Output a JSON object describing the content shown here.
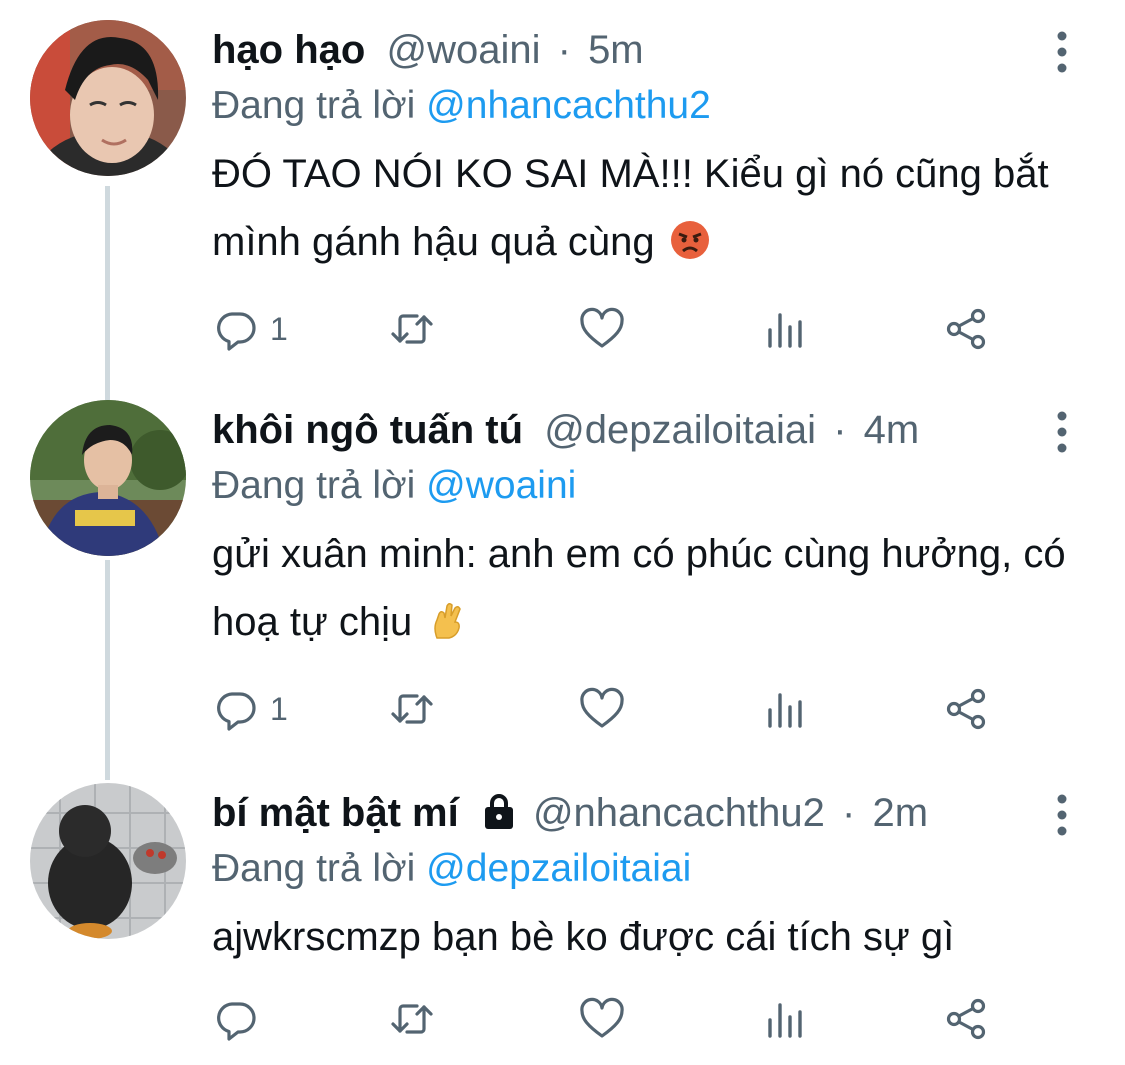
{
  "tweets": [
    {
      "name": "hạo hạo",
      "handle": "@woaini",
      "sep": "·",
      "time": "5m",
      "reply_prefix": "Đang trả lời",
      "reply_to": "@nhancachthu2",
      "text": "ĐÓ TAO NÓI KO SAI MÀ!!! Kiểu gì nó cũng bắt mình gánh hậu quả cùng",
      "emoji_icon": "angry-face-icon",
      "reply_count": "1",
      "locked": false
    },
    {
      "name": "khôi ngô tuấn tú",
      "handle": "@depzailoitaiai",
      "sep": "·",
      "time": "4m",
      "reply_prefix": "Đang trả lời",
      "reply_to": "@woaini",
      "text": "gửi xuân minh: anh em có phúc cùng hưởng, có hoạ tự chịu",
      "emoji_icon": "crossed-fingers-icon",
      "reply_count": "1",
      "locked": false
    },
    {
      "name": "bí mật bật mí",
      "handle": "@nhancachthu2",
      "sep": "·",
      "time": "2m",
      "reply_prefix": "Đang trả lời",
      "reply_to": "@depzailoitaiai",
      "text": "ajwkrscmzp bạn bè ko được cái tích sự gì",
      "emoji_icon": "",
      "reply_count": "",
      "locked": true
    }
  ],
  "colors": {
    "text": "#0f1419",
    "secondary": "#536471",
    "link": "#1d9bf0",
    "thread_line": "#cfd9de"
  }
}
